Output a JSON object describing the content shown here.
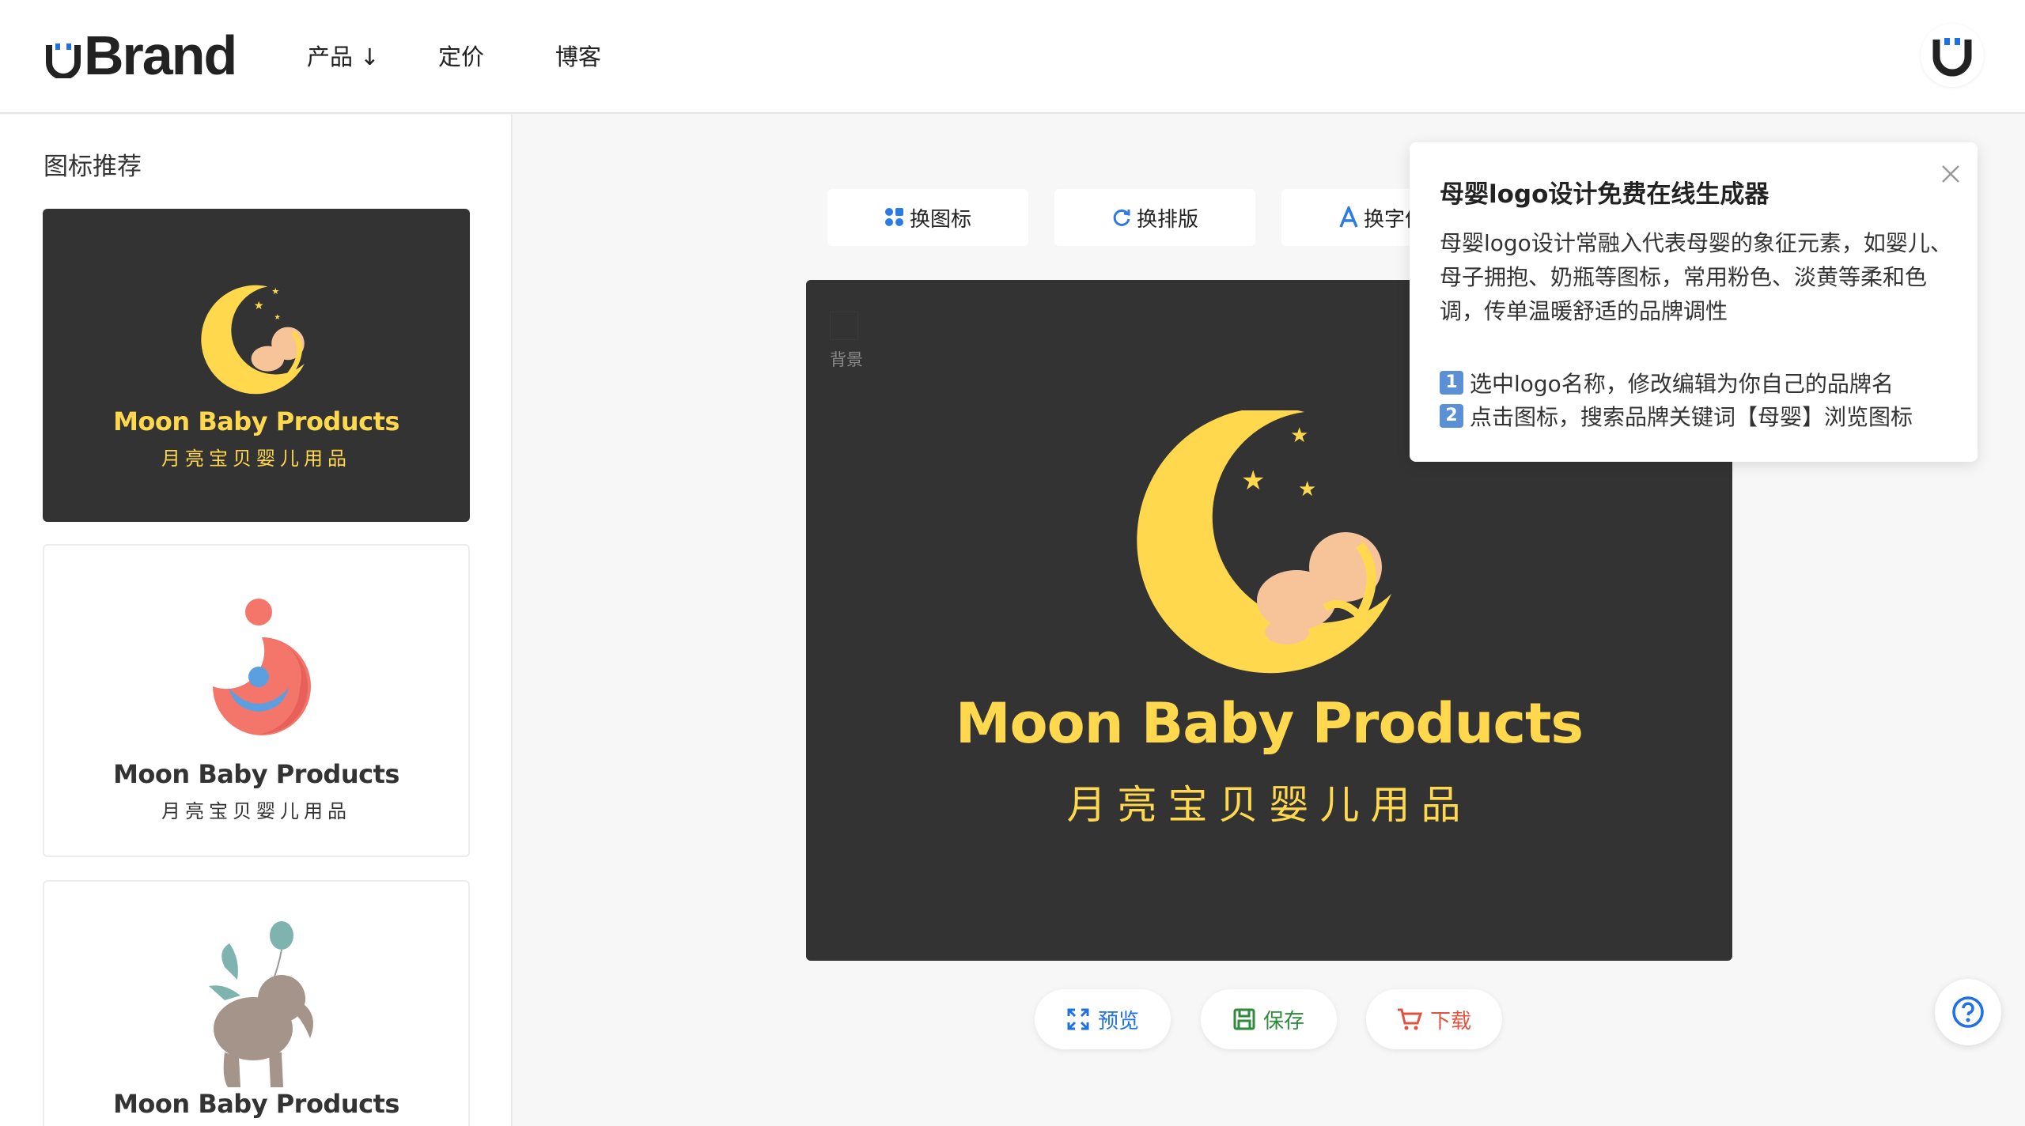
{
  "header": {
    "logo_text": "Brand",
    "nav": {
      "products": "产品 ↓",
      "pricing": "定价",
      "blog": "博客"
    }
  },
  "sidebar": {
    "title": "图标推荐",
    "cards": [
      {
        "name": "Moon Baby Products",
        "subtitle": "月亮宝贝婴儿用品",
        "background": "#333333",
        "text_color": "#ffd84d"
      },
      {
        "name": "Moon Baby Products",
        "subtitle": "月亮宝贝婴儿用品",
        "background": "#ffffff",
        "text_color": "#333333"
      },
      {
        "name": "Moon Baby Products",
        "subtitle": "",
        "background": "#ffffff",
        "text_color": "#333333"
      }
    ]
  },
  "toolbar": {
    "change_icon": "换图标",
    "change_layout": "换排版",
    "change_font": "换字体"
  },
  "canvas": {
    "background_label": "背景",
    "brand_name": "Moon Baby Products",
    "brand_subtitle": "月亮宝贝婴儿用品",
    "background_color": "#333333",
    "text_color": "#ffd84d"
  },
  "actions": {
    "preview": "预览",
    "save": "保存",
    "download": "下载"
  },
  "popup": {
    "title": "母婴logo设计免费在线生成器",
    "body": "母婴logo设计常融入代表母婴的象征元素，如婴儿、母子拥抱、奶瓶等图标，常用粉色、淡黄等柔和色调，传单温暖舒适的品牌调性",
    "step1_num": "1",
    "step1": "选中logo名称，修改编辑为你自己的品牌名",
    "step2_num": "2",
    "step2": "点击图标，搜索品牌关键词【母婴】浏览图标"
  },
  "colors": {
    "brand_blue": "#1f6fe5",
    "accent_yellow": "#ffd84d",
    "save_green": "#2e8b3a",
    "download_red": "#e0533f"
  }
}
